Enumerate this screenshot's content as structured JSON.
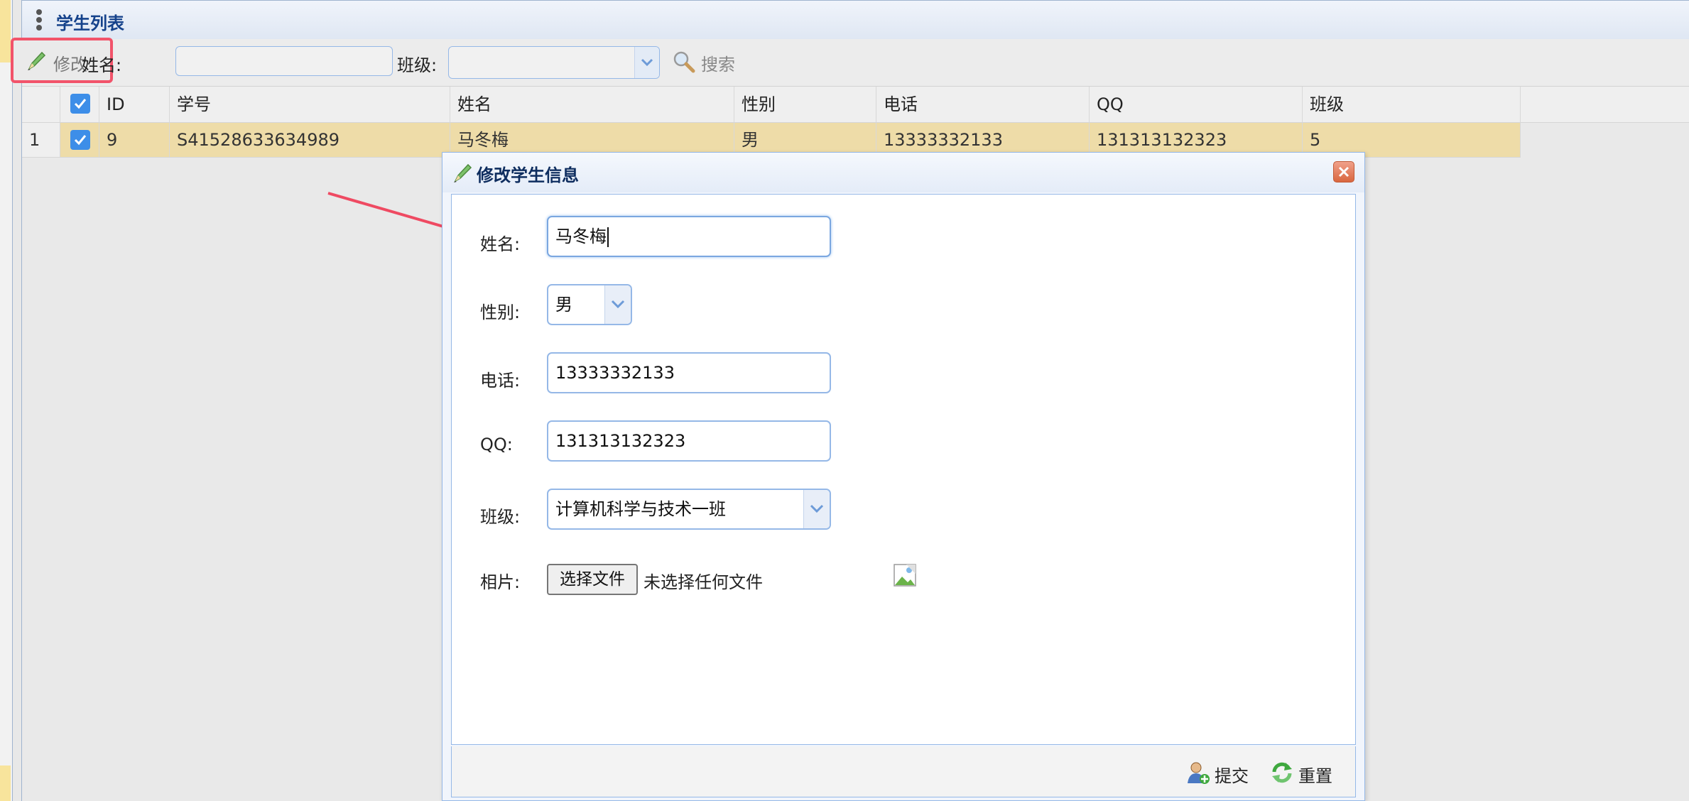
{
  "panel": {
    "title": "学生列表"
  },
  "toolbar": {
    "edit_label": "修改",
    "name_label": "姓名:",
    "name_value": "",
    "class_label": "班级:",
    "class_value": "",
    "search_label": "搜索"
  },
  "grid": {
    "columns": [
      "ID",
      "学号",
      "姓名",
      "性别",
      "电话",
      "QQ",
      "班级"
    ],
    "rows": [
      {
        "rownum": "1",
        "id": "9",
        "sn": "S41528633634989",
        "name": "马冬梅",
        "sex": "男",
        "phone": "13333332133",
        "qq": "131313132323",
        "clazz": "5"
      }
    ]
  },
  "dialog": {
    "title": "修改学生信息",
    "fields": {
      "name": {
        "label": "姓名:",
        "value": "马冬梅"
      },
      "sex": {
        "label": "性别:",
        "value": "男"
      },
      "phone": {
        "label": "电话:",
        "value": "13333332133"
      },
      "qq": {
        "label": "QQ:",
        "value": "131313132323"
      },
      "clazz": {
        "label": "班级:",
        "value": "计算机科学与技术一班"
      },
      "photo": {
        "label": "相片:",
        "button": "选择文件",
        "status": "未选择任何文件"
      }
    },
    "submit_label": "提交",
    "reset_label": "重置"
  },
  "colors": {
    "accent": "#95b8e7",
    "highlight": "#f2536a",
    "row_selected": "#eedca8",
    "title": "#15428b"
  },
  "icons": [
    "pencil-icon",
    "search-icon",
    "checkbox-checked-icon",
    "close-icon",
    "chevron-down-icon",
    "submit-user-icon",
    "reset-refresh-icon",
    "broken-image-icon"
  ]
}
